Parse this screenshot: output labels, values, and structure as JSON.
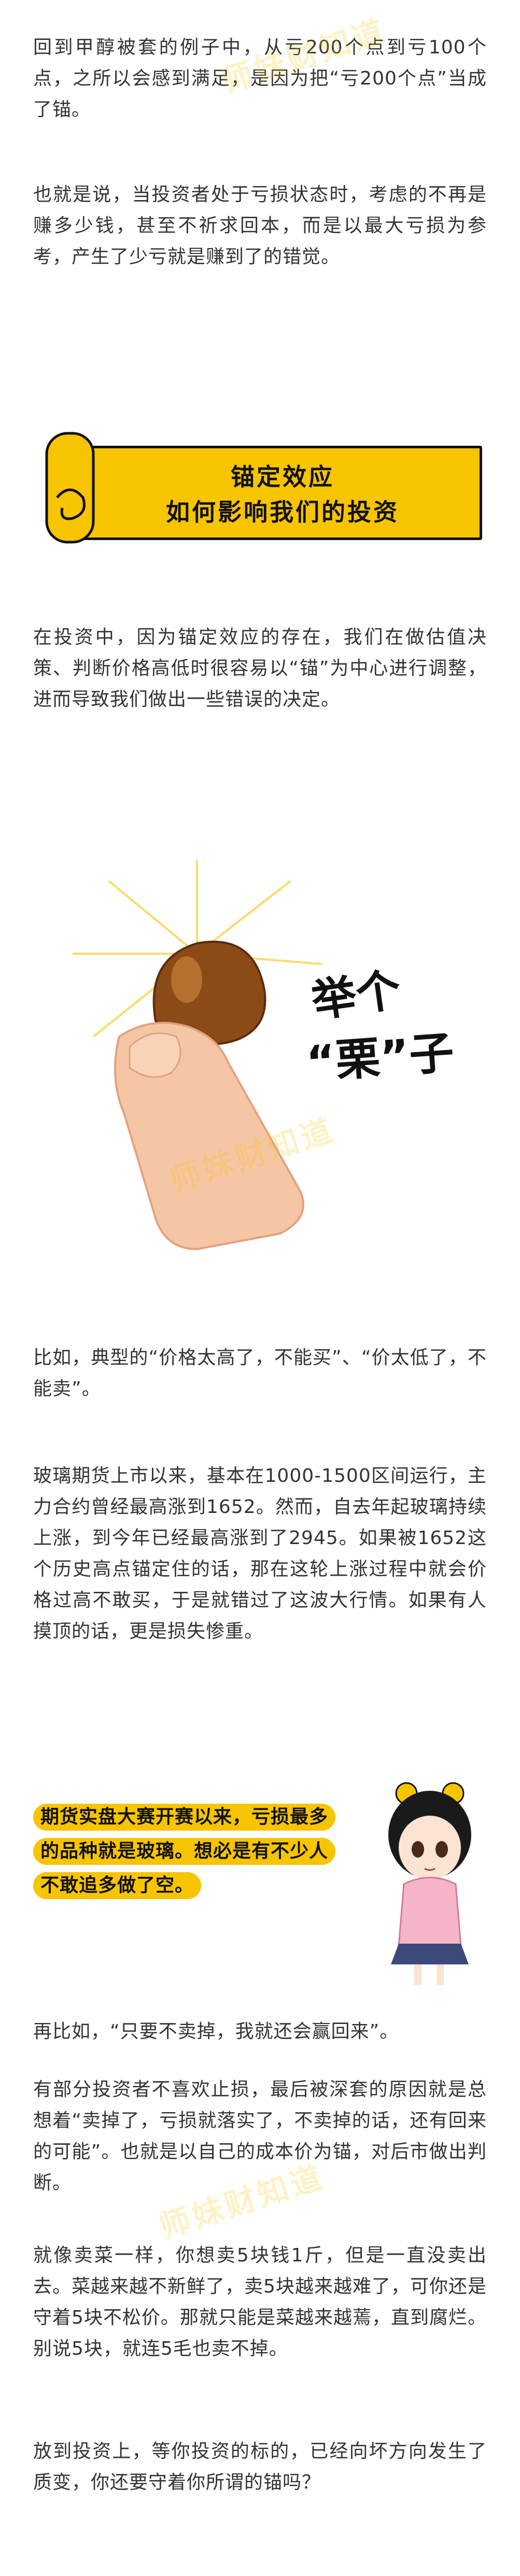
{
  "paragraphs": {
    "p1": "回到甲醇被套的例子中，从亏200个点到亏100个点，之所以会感到满足，是因为把“亏200个点”当成了锚。",
    "p2": "也就是说，当投资者处于亏损状态时，考虑的不再是赚多少钱，甚至不祈求回本，而是以最大亏损为参考，产生了少亏就是赚到了的错觉。",
    "p3": "在投资中，因为锚定效应的存在，我们在做估值决策、判断价格高低时很容易以“锚”为中心进行调整，进而导致我们做出一些错误的决定。",
    "p4": "比如，典型的“价格太高了，不能买”、“价太低了，不能卖”。",
    "p5": "玻璃期货上市以来，基本在1000-1500区间运行，主力合约曾经最高涨到1652。然而，自去年起玻璃持续上涨，到今年已经最高涨到了2945。如果被1652这个历史高点锚定住的话，那在这轮上涨过程中就会价格过高不敢买，于是就错过了这波大行情。如果有人摸顶的话，更是损失惨重。",
    "p6": "再比如，“只要不卖掉，我就还会赢回来”。",
    "p7": "有部分投资者不喜欢止损，最后被深套的原因就是总想着“卖掉了，亏损就落实了，不卖掉的话，还有回来的可能”。也就是以自己的成本价为锚，对后市做出判断。",
    "p8": "就像卖菜一样，你想卖5块钱1斤，但是一直没卖出去。菜越来越不新鲜了，卖5块越来越难了，可你还是守着5块不松价。那就只能是菜越来越蔫，直到腐烂。别说5块，就连5毛也卖不掉。",
    "p9": "放到投资上，等你投资的标的，已经向坏方向发生了质变，你还要守着你所谓的锚吗？"
  },
  "banner": {
    "line1": "锚定效应",
    "line2": "如何影响我们的投资"
  },
  "illustration": {
    "caption_line1": "举个",
    "caption_line2": "“栗”子"
  },
  "callout": {
    "line1": "期货实盘大赛开赛以来，亏损最多",
    "line2": "的品种就是玻璃。想必是有不少人",
    "line3": "不敢追多做了空。"
  },
  "watermark": "师妹财知道",
  "colors": {
    "accent": "#f7c400",
    "text": "#333333"
  }
}
